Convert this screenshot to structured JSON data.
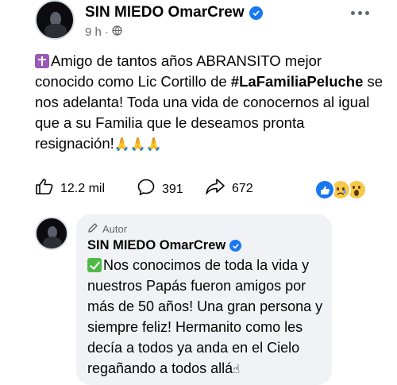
{
  "post": {
    "author": "SIN MIEDO OmarCrew",
    "time": "9 h",
    "separator": "·",
    "text_before": "Amigo de tantos años ABRANSITO mejor conocido como Lic Cortillo de ",
    "hashtag": "#LaFamiliaPeluche",
    "text_after": " se nos adelanta! Toda una vida de conocernos al igual que a su Familia que le deseamos pronta resignación!",
    "emoji_end": "🙏🙏🙏"
  },
  "actions": {
    "likes": "12.2 mil",
    "comments": "391",
    "shares": "672"
  },
  "reply": {
    "tag": "Autor",
    "author": "SIN MIEDO OmarCrew",
    "text": "Nos conocimos de toda la vida y nuestros Papás fueron amigos por más de 50 años! Una gran persona y siempre feliz! Hermanito como les decía a todos ya anda en el Cielo regañando a todos allá",
    "emoji_end": "☝"
  },
  "colors": {
    "verified": "#1877f2",
    "secondary_text": "#65676b",
    "bubble_bg": "#f0f2f5"
  },
  "icons": [
    "verified-icon",
    "globe-icon",
    "more-icon",
    "like-icon",
    "comment-icon",
    "share-icon",
    "like-reaction-icon",
    "sad-reaction-icon",
    "wow-reaction-icon",
    "pencil-icon"
  ]
}
